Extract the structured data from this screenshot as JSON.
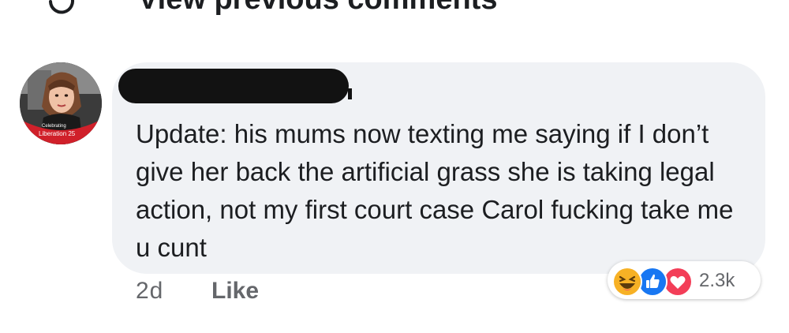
{
  "previous_comments": {
    "label": "View previous comments",
    "icon": "refresh-icon"
  },
  "comment": {
    "avatar_icon": "avatar-photo",
    "avatar_badge_line1": "Celebrating",
    "avatar_badge_line2": "Liberation 25",
    "author_redacted": true,
    "text": "Update: his mums now texting me saying if I don’t give her back the artificial grass she is taking legal action, not my first court case Carol fucking take me u cunt",
    "time": "2d",
    "like_label": "Like",
    "reactions": {
      "icons": [
        "haha-reaction-icon",
        "like-reaction-icon",
        "love-reaction-icon"
      ],
      "count": "2.3k"
    }
  },
  "colors": {
    "bubble": "#f0f2f5",
    "text": "#1c1e21",
    "secondary": "#65676b",
    "like_blue": "#1877f2",
    "love_red": "#f33e58",
    "haha_yellow": "#f7b125"
  }
}
